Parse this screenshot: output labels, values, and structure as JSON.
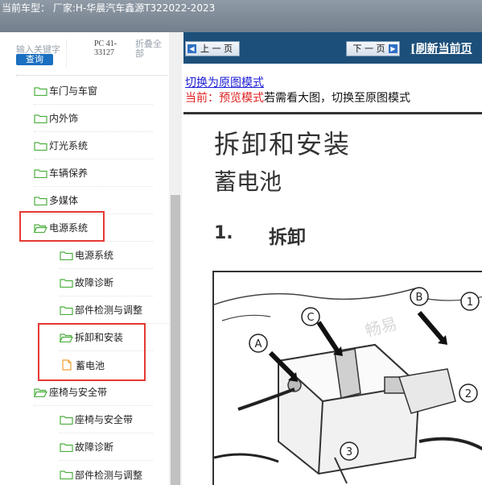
{
  "header": {
    "text": "当前车型：  厂家:H-华晨汽车鑫源T322022-2023"
  },
  "sidebar": {
    "search_label": "输入关键字",
    "search_button": "查询",
    "model_code": "PC 41-33127",
    "collapse_all": "折叠全部",
    "items": [
      {
        "label": "车门与车窗",
        "icon": "folder-icon"
      },
      {
        "label": "内外饰",
        "icon": "folder-icon"
      },
      {
        "label": "灯光系统",
        "icon": "folder-icon"
      },
      {
        "label": "车辆保养",
        "icon": "folder-icon"
      },
      {
        "label": "多媒体",
        "icon": "folder-icon"
      },
      {
        "label": "电源系统",
        "icon": "folder-open-icon"
      },
      {
        "label": "电源系统",
        "icon": "folder-icon"
      },
      {
        "label": "故障诊断",
        "icon": "folder-icon"
      },
      {
        "label": "部件检测与调整",
        "icon": "folder-icon"
      },
      {
        "label": "拆卸和安装",
        "icon": "folder-open-icon"
      },
      {
        "label": "蓄电池",
        "icon": "document-icon"
      },
      {
        "label": "座椅与安全带",
        "icon": "folder-open-icon"
      },
      {
        "label": "座椅与安全带",
        "icon": "folder-icon"
      },
      {
        "label": "故障诊断",
        "icon": "folder-icon"
      },
      {
        "label": "部件检测与调整",
        "icon": "folder-icon"
      }
    ]
  },
  "toolbar": {
    "prev_label": "上 一 页",
    "next_label": "下 一 页",
    "refresh_label": "[刷新当前页"
  },
  "content": {
    "switch_link": "切换为原图模式",
    "current_prefix": "当前：预览模式",
    "current_suffix": "若需看大图，切换至原图模式",
    "title": "拆卸和安装",
    "subtitle": "蓄电池",
    "step_number": "1.",
    "step_text": "拆卸",
    "figure_labels": [
      "A",
      "B",
      "C",
      "1",
      "2",
      "3"
    ],
    "watermark": "畅易"
  },
  "colors": {
    "toolbar_bg": "#1c4f7a",
    "highlight_box": "#e53935",
    "search_button": "#1a6fc0",
    "folder_green": "#4caf3f"
  }
}
